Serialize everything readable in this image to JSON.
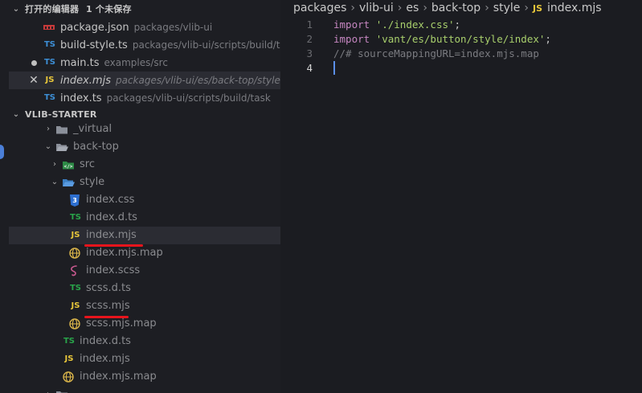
{
  "open_editors": {
    "header_label": "打开的编辑器",
    "unsaved_label": "1 个未保存",
    "items": [
      {
        "icon": "npm-icon",
        "name": "package.json",
        "path": "packages/vlib-ui"
      },
      {
        "icon": "TS",
        "name": "build-style.ts",
        "path": "packages/vlib-ui/scripts/build/t..."
      },
      {
        "icon": "TS",
        "name": "main.ts",
        "path": "examples/src"
      },
      {
        "icon": "JS",
        "name": "index.mjs",
        "path": "packages/vlib-ui/es/back-top/style"
      },
      {
        "icon": "TS",
        "name": "index.ts",
        "path": "packages/vlib-ui/scripts/build/task"
      }
    ]
  },
  "explorer": {
    "root_label": "VLIB-STARTER",
    "items": [
      {
        "name": "_virtual",
        "icon": "folder-icon"
      },
      {
        "name": "back-top",
        "icon": "folder-open-icon"
      },
      {
        "name": "src",
        "icon": "folder-src-icon"
      },
      {
        "name": "style",
        "icon": "folder-style-icon"
      },
      {
        "name": "index.css",
        "icon": "css-icon"
      },
      {
        "name": "index.d.ts",
        "icon": "TS"
      },
      {
        "name": "index.mjs",
        "icon": "JS"
      },
      {
        "name": "index.mjs.map",
        "icon": "globe-icon"
      },
      {
        "name": "index.scss",
        "icon": "sass-icon"
      },
      {
        "name": "scss.d.ts",
        "icon": "TS"
      },
      {
        "name": "scss.mjs",
        "icon": "JS"
      },
      {
        "name": "scss.mjs.map",
        "icon": "globe-icon"
      },
      {
        "name": "index.d.ts",
        "icon": "TS"
      },
      {
        "name": "index.mjs",
        "icon": "JS"
      },
      {
        "name": "index.mjs.map",
        "icon": "globe-icon"
      }
    ]
  },
  "breadcrumb": [
    "packages",
    "vlib-ui",
    "es",
    "back-top",
    "style",
    "index.mjs"
  ],
  "breadcrumb_file_icon": "JS",
  "code": {
    "lines": [
      {
        "num": "1",
        "kw": "import",
        "str": "'./index.css'",
        "end": ";"
      },
      {
        "num": "2",
        "kw": "import",
        "str": "'vant/es/button/style/index'",
        "end": ";"
      },
      {
        "num": "3",
        "comment": "//# sourceMappingURL=index.mjs.map"
      },
      {
        "num": "4"
      }
    ]
  },
  "colors": {
    "annotation_underline": "#e8141c",
    "ts_icon": "#3d8fd6",
    "js_icon": "#e8c63a",
    "cursor": "#5b8fe8"
  }
}
